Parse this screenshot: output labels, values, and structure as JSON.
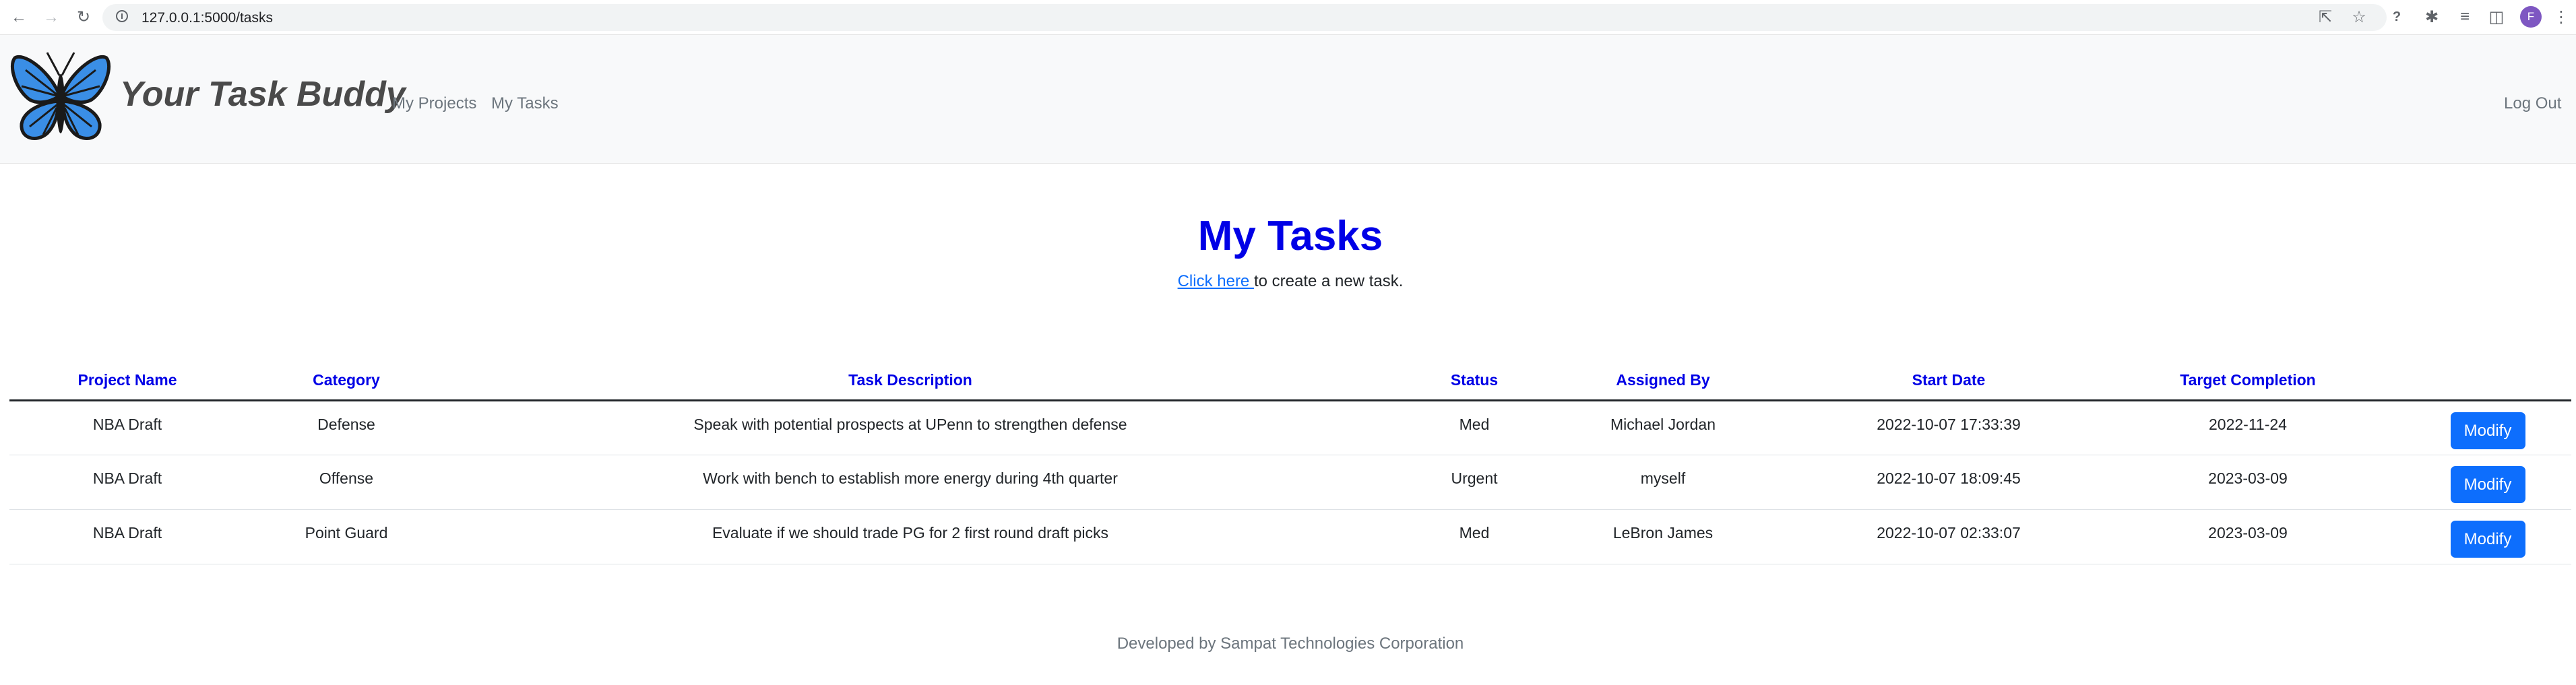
{
  "browser": {
    "url": "127.0.0.1:5000/tasks",
    "avatar_letter": "F"
  },
  "navbar": {
    "brand": "Your Task Buddy",
    "links": [
      "My Projects",
      "My Tasks"
    ],
    "logout": "Log Out",
    "logo_color": "#3a8ee6"
  },
  "main": {
    "title": "My Tasks",
    "create_link": "Click here ",
    "create_text": "to create a new task."
  },
  "table": {
    "headers": [
      "Project Name",
      "Category",
      "Task Description",
      "Status",
      "Assigned By",
      "Start Date",
      "Target Completion",
      ""
    ],
    "rows": [
      {
        "project": "NBA Draft",
        "category": "Defense",
        "description": "Speak with potential prospects at UPenn to strengthen defense",
        "status": "Med",
        "assigned_by": "Michael Jordan",
        "start_date": "2022-10-07 17:33:39",
        "target": "2022-11-24",
        "action": "Modify"
      },
      {
        "project": "NBA Draft",
        "category": "Offense",
        "description": "Work with bench to establish more energy during 4th quarter",
        "status": "Urgent",
        "assigned_by": "myself",
        "start_date": "2022-10-07 18:09:45",
        "target": "2023-03-09",
        "action": "Modify"
      },
      {
        "project": "NBA Draft",
        "category": "Point Guard",
        "description": "Evaluate if we should trade PG for 2 first round draft picks",
        "status": "Med",
        "assigned_by": "LeBron James",
        "start_date": "2022-10-07 02:33:07",
        "target": "2023-03-09",
        "action": "Modify"
      }
    ]
  },
  "footer": "Developed by Sampat Technologies Corporation",
  "colors": {
    "heading": "#0000e6",
    "button": "#0d6efd",
    "navbar_bg": "#f8f9fa"
  }
}
